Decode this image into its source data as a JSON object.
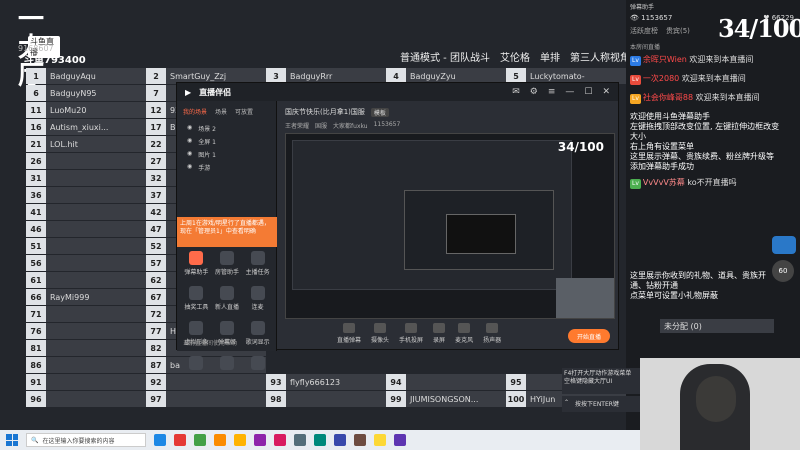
{
  "overlay": {
    "logo_text": "一大厅",
    "logo_tag": "斗鱼直播",
    "logo_id": "9168607",
    "room_id": "斗鱼793400",
    "mode_items": [
      "普通模式 - 团队战斗",
      "艾伦格",
      "单排",
      "第三人称视角",
      "AS"
    ]
  },
  "scoreboard": {
    "rows": [
      [
        {
          "n": "1",
          "name": "BadguyAqu"
        },
        {
          "n": "2",
          "name": "SmartGuy_Zzj"
        },
        {
          "n": "3",
          "name": "BadguyRrr"
        },
        {
          "n": "4",
          "name": "BadguyZyu"
        },
        {
          "n": "5",
          "name": "Luckytomato-"
        }
      ],
      [
        {
          "n": "6",
          "name": "BadguyN95"
        },
        {
          "n": "7",
          "name": ""
        },
        {
          "n": "",
          "name": ""
        },
        {
          "n": "",
          "name": ""
        },
        {
          "n": "",
          "name": ""
        }
      ],
      [
        {
          "n": "11",
          "name": "LuoMu20"
        },
        {
          "n": "12",
          "name": "92"
        },
        {
          "n": "",
          "name": ""
        },
        {
          "n": "",
          "name": ""
        },
        {
          "n": "",
          "name": ""
        }
      ],
      [
        {
          "n": "16",
          "name": "Autism_xiuxi..."
        },
        {
          "n": "17",
          "name": "Ba"
        },
        {
          "n": "",
          "name": ""
        },
        {
          "n": "",
          "name": ""
        },
        {
          "n": "",
          "name": ""
        }
      ],
      [
        {
          "n": "21",
          "name": "LOL.hit"
        },
        {
          "n": "22",
          "name": ""
        },
        {
          "n": "",
          "name": ""
        },
        {
          "n": "",
          "name": ""
        },
        {
          "n": "",
          "name": ""
        }
      ],
      [
        {
          "n": "26",
          "name": ""
        },
        {
          "n": "27",
          "name": ""
        },
        {
          "n": "",
          "name": ""
        },
        {
          "n": "",
          "name": ""
        },
        {
          "n": "",
          "name": ""
        }
      ],
      [
        {
          "n": "31",
          "name": ""
        },
        {
          "n": "32",
          "name": ""
        },
        {
          "n": "",
          "name": ""
        },
        {
          "n": "",
          "name": ""
        },
        {
          "n": "",
          "name": ""
        }
      ],
      [
        {
          "n": "36",
          "name": ""
        },
        {
          "n": "37",
          "name": ""
        },
        {
          "n": "",
          "name": ""
        },
        {
          "n": "",
          "name": ""
        },
        {
          "n": "",
          "name": ""
        }
      ],
      [
        {
          "n": "41",
          "name": ""
        },
        {
          "n": "42",
          "name": ""
        },
        {
          "n": "",
          "name": ""
        },
        {
          "n": "",
          "name": ""
        },
        {
          "n": "",
          "name": ""
        }
      ],
      [
        {
          "n": "46",
          "name": ""
        },
        {
          "n": "47",
          "name": ""
        },
        {
          "n": "",
          "name": ""
        },
        {
          "n": "",
          "name": ""
        },
        {
          "n": "",
          "name": ""
        }
      ],
      [
        {
          "n": "51",
          "name": ""
        },
        {
          "n": "52",
          "name": ""
        },
        {
          "n": "",
          "name": ""
        },
        {
          "n": "",
          "name": ""
        },
        {
          "n": "",
          "name": ""
        }
      ],
      [
        {
          "n": "56",
          "name": ""
        },
        {
          "n": "57",
          "name": ""
        },
        {
          "n": "",
          "name": ""
        },
        {
          "n": "",
          "name": ""
        },
        {
          "n": "",
          "name": ""
        }
      ],
      [
        {
          "n": "61",
          "name": ""
        },
        {
          "n": "62",
          "name": ""
        },
        {
          "n": "",
          "name": ""
        },
        {
          "n": "",
          "name": ""
        },
        {
          "n": "",
          "name": ""
        }
      ],
      [
        {
          "n": "66",
          "name": "RayMi999"
        },
        {
          "n": "67",
          "name": ""
        },
        {
          "n": "",
          "name": ""
        },
        {
          "n": "",
          "name": ""
        },
        {
          "n": "",
          "name": ""
        }
      ],
      [
        {
          "n": "71",
          "name": ""
        },
        {
          "n": "72",
          "name": ""
        },
        {
          "n": "",
          "name": ""
        },
        {
          "n": "",
          "name": ""
        },
        {
          "n": "",
          "name": ""
        }
      ],
      [
        {
          "n": "76",
          "name": ""
        },
        {
          "n": "77",
          "name": "Ho"
        },
        {
          "n": "",
          "name": ""
        },
        {
          "n": "",
          "name": ""
        },
        {
          "n": "",
          "name": ""
        }
      ],
      [
        {
          "n": "81",
          "name": ""
        },
        {
          "n": "82",
          "name": ""
        },
        {
          "n": "",
          "name": ""
        },
        {
          "n": "",
          "name": ""
        },
        {
          "n": "",
          "name": ""
        }
      ],
      [
        {
          "n": "86",
          "name": ""
        },
        {
          "n": "87",
          "name": "ba"
        },
        {
          "n": "",
          "name": ""
        },
        {
          "n": "",
          "name": ""
        },
        {
          "n": "",
          "name": ""
        }
      ],
      [
        {
          "n": "91",
          "name": ""
        },
        {
          "n": "92",
          "name": ""
        },
        {
          "n": "93",
          "name": "flyfly666123"
        },
        {
          "n": "94",
          "name": ""
        },
        {
          "n": "95",
          "name": ""
        }
      ],
      [
        {
          "n": "96",
          "name": ""
        },
        {
          "n": "97",
          "name": ""
        },
        {
          "n": "98",
          "name": ""
        },
        {
          "n": "99",
          "name": "JIUMISONGSON..."
        },
        {
          "n": "100",
          "name": "HYiJun"
        }
      ]
    ]
  },
  "app": {
    "title": "直播伴侣",
    "scene_title": "国庆节快乐(比月拿1)国服",
    "scene_tag": "模板",
    "scene_meta": [
      "王者荣耀",
      "国服",
      "大家都fuxku",
      "1153657"
    ],
    "side_tabs": [
      "我的场景",
      "场景",
      "可放置"
    ],
    "layers": [
      "场景 2",
      "全屏 1",
      "图片 1",
      "手游"
    ],
    "promo_text": "上周1在游戏/明星行了直播都遇，现在「管理员1」中查看明确",
    "tools": [
      {
        "label": "弹幕助手",
        "active": true
      },
      {
        "label": "房管助手",
        "active": false
      },
      {
        "label": "主播任务",
        "active": false
      },
      {
        "label": "抽奖工具",
        "active": false
      },
      {
        "label": "新人直播",
        "active": false
      },
      {
        "label": "连麦",
        "active": false
      },
      {
        "label": "虚拟形象",
        "active": false
      },
      {
        "label": "弹幕姬",
        "active": false
      },
      {
        "label": "歌词显示",
        "active": false
      },
      {
        "label": "",
        "active": false
      },
      {
        "label": "",
        "active": false
      },
      {
        "label": "",
        "active": false
      }
    ],
    "side_footer": "当前直播间使用帮助",
    "bottom_tools": [
      "直播弹幕",
      "摄像头",
      "手机投屏",
      "录屏",
      "麦克风",
      "扬声器"
    ],
    "start_label": "开始直播"
  },
  "right_panel": {
    "title": "弹幕助手",
    "viewers": "1153657",
    "score": "34/100",
    "right_num": "66229",
    "rank_line": [
      "活跃度榜",
      "贵宾(5)"
    ],
    "section_label": "本房间直播",
    "messages": [
      {
        "badge": "Lv",
        "user": "余晖只Wien",
        "text": "欢迎来到本直播间"
      },
      {
        "badge": "Lv",
        "user": "一次2080",
        "text": "欢迎来到本直播间"
      },
      {
        "badge": "Lv",
        "user": "社会你峰哥88",
        "text": "欢迎来到本直播间"
      }
    ],
    "helper_text": "欢迎使用斗鱼弹幕助手\n左键拖拽顶部改变位置, 左键拉伸边框改变大小\n右上角有设置菜单\n这里展示弹幕、贵族续费、粉丝牌升级等\n添加弹幕助手成功",
    "last_msg": {
      "user": "VvVvV苏幕",
      "text": "ko不开直播吗"
    },
    "gift_text": "这里展示你收到的礼物、道具、贵族开通、钻粉开通\n点菜单可设置小礼物屏蔽",
    "unassigned": "未分配 (0)",
    "side_num": "60"
  },
  "hints": {
    "hint_text": "F4打开大厅动作游戏菜单\n空格键隐藏大厅UI",
    "enter_text": "按按下ENTER键"
  },
  "taskbar": {
    "search_placeholder": "在这里输入你要搜索的内容",
    "apps": [
      "#1e88e5",
      "#e53935",
      "#43a047",
      "#fb8c00",
      "#ffb300",
      "#8e24aa",
      "#d81b60",
      "#546e7a",
      "#00897b",
      "#3949ab",
      "#6d4c41",
      "#fdd835",
      "#5e35b1"
    ]
  }
}
